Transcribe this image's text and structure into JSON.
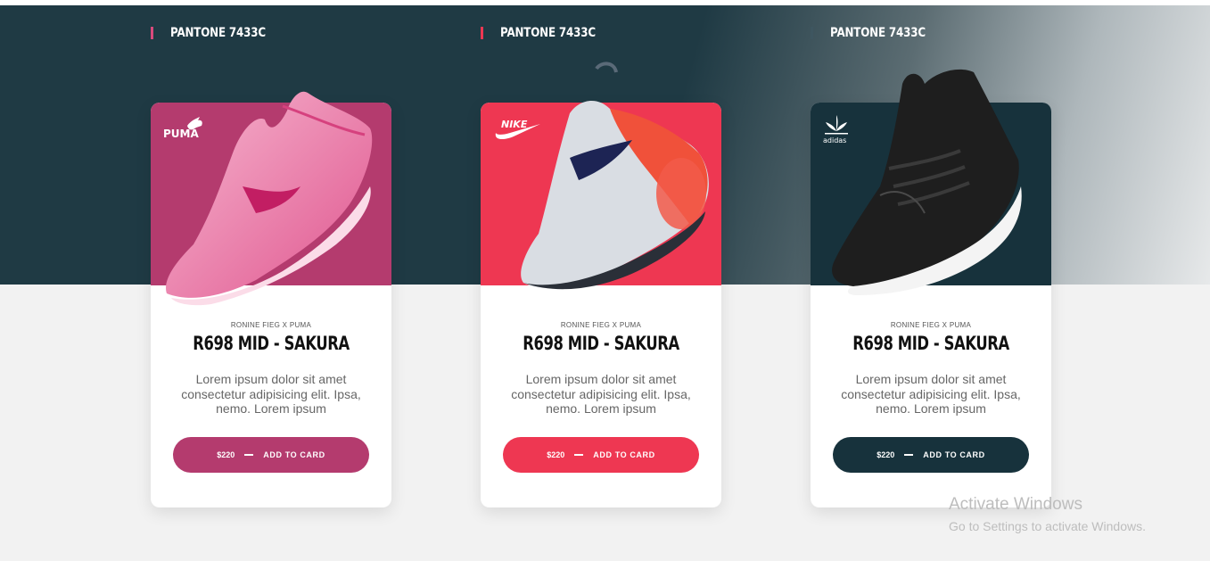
{
  "cards": [
    {
      "pantone": "PANTONE 7433C",
      "brand": "PUMA",
      "brand_icon": "puma-logo-icon",
      "accent": "#b43b6e",
      "pantone_bar": "#d94a7c",
      "subtitle": "RONINE FIEG X PUMA",
      "title": "R698 MID - SAKURA",
      "description": "Lorem ipsum dolor sit amet consectetur adipisicing elit. Ipsa, nemo. Lorem ipsum",
      "price": "$220",
      "button_label": "ADD TO CARD"
    },
    {
      "pantone": "PANTONE 7433C",
      "brand": "NIKE",
      "brand_icon": "nike-logo-icon",
      "accent": "#ee3752",
      "pantone_bar": "#ee3752",
      "subtitle": "RONINE FIEG X PUMA",
      "title": "R698 MID - SAKURA",
      "description": "Lorem ipsum dolor sit amet consectetur adipisicing elit. Ipsa, nemo. Lorem ipsum",
      "price": "$220",
      "button_label": "ADD TO CARD"
    },
    {
      "pantone": "PANTONE 7433C",
      "brand": "adidas",
      "brand_icon": "adidas-logo-icon",
      "accent": "#17323c",
      "pantone_bar": "#17323c",
      "subtitle": "RONINE FIEG X PUMA",
      "title": "R698 MID - SAKURA",
      "description": "Lorem ipsum dolor sit amet consectetur adipisicing elit. Ipsa, nemo. Lorem ipsum",
      "price": "$220",
      "button_label": "ADD TO CARD"
    }
  ],
  "watermark": {
    "line1": "Activate Windows",
    "line2": "Go to Settings to activate Windows."
  }
}
